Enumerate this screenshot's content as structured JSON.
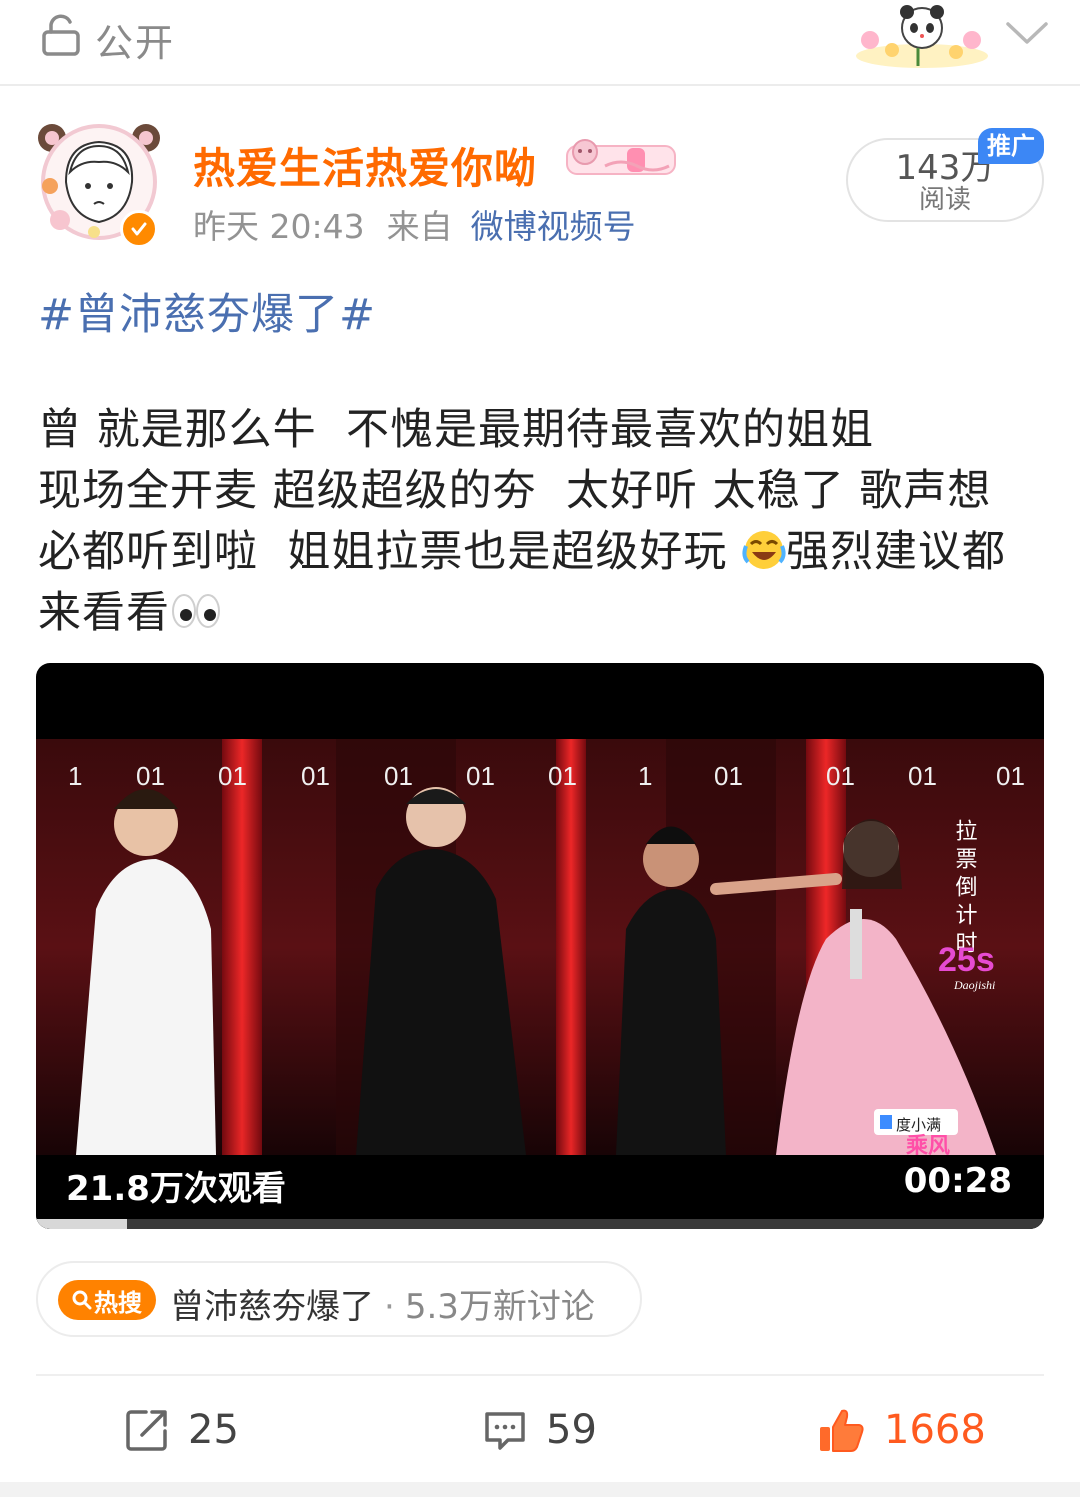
{
  "header": {
    "privacy_label": "公开",
    "icons": [
      "lock-icon",
      "chevron-down-icon"
    ]
  },
  "author": {
    "name": "热爱生活热爱你呦",
    "time": "昨天 20:43",
    "from_label": "来自",
    "source": "微博视频号",
    "verified_color": "#ff8a00",
    "name_color": "#ff6a00"
  },
  "stats": {
    "reads": "143万",
    "reads_label": "阅读",
    "promo_tag": "推广",
    "promo_color": "#3c87f5"
  },
  "post": {
    "hashtag": "#曾沛慈夯爆了#",
    "lines": [
      "曾 就是那么牛  不愧是最期待最喜欢的姐姐",
      "现场全开麦 超级超级的夯  太好听 太稳了 歌声想",
      "必都听到啦  姐姐拉票也是超级好玩 ",
      "来看看"
    ],
    "line3_tail": "强烈建议都",
    "emojis": [
      "crying-laughing-emoji",
      "eyes-emoji"
    ]
  },
  "video": {
    "views": "21.8万次观看",
    "duration": "00:28",
    "progress": 0.09,
    "scene_numbers": [
      "1",
      "01",
      "01",
      "01",
      "01",
      "01",
      "01",
      "1",
      "01",
      "01",
      "01",
      "01"
    ],
    "vote_caption": "拉票倒计时",
    "countdown": "25s",
    "countdown_script": "Daojishi",
    "sponsor": "度小满",
    "stage_text": "乘风"
  },
  "hot_search": {
    "badge": "热搜",
    "topic": "曾沛慈夯爆了",
    "separator": "·",
    "discussions": "5.3万新讨论",
    "badge_color": "#ff8200"
  },
  "actions": {
    "reposts": "25",
    "comments": "59",
    "likes": "1668",
    "like_color": "#ff5a1f"
  }
}
